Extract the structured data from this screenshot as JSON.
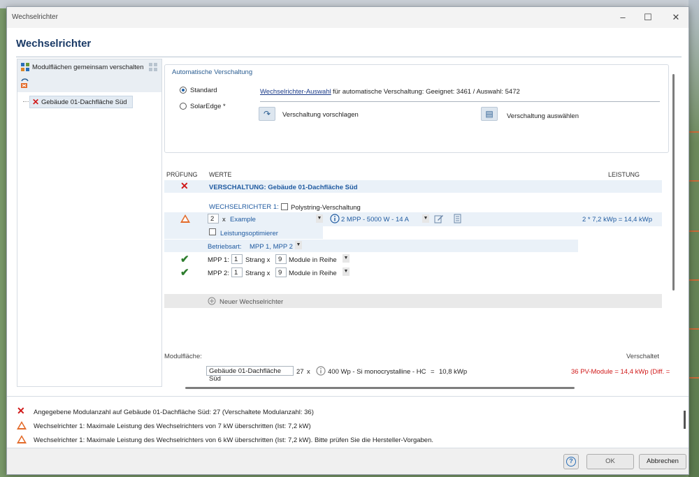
{
  "window": {
    "title": "Wechselrichter",
    "heading": "Wechselrichter"
  },
  "tree": {
    "group_label": "Modulflächen gemeinsam verschalten",
    "item_label": "Gebäude 01-Dachfläche Süd"
  },
  "auto": {
    "title": "Automatische Verschaltung",
    "option_standard": "Standard",
    "option_solaredge": "SolarEdge *",
    "selection_link": "Wechselrichter-Auswahl",
    "selection_text": "für automatische Verschaltung: Geeignet: 3461 / Auswahl: 5472",
    "suggest_label": "Verschaltung vorschlagen",
    "choose_label": "Verschaltung auswählen"
  },
  "columns": {
    "check": "PRÜFUNG",
    "values": "WERTE",
    "power": "LEISTUNG"
  },
  "wiring": {
    "title": "VERSCHALTUNG: Gebäude 01-Dachfläche Süd",
    "inverter_label": "WECHSELRICHTER 1:",
    "polystring_label": "Polystring-Verschaltung",
    "count": "2",
    "x_sep": "x",
    "model": "Example",
    "mpp_info": "2 MPP - 5000 W - 14 A",
    "power_result": "2 * 7,2 kWp = 14,4 kWp",
    "optimizer_label": "Leistungsoptimierer",
    "mode_label": "Betriebsart:",
    "mode_value": "MPP 1, MPP 2",
    "mpps": [
      {
        "label": "MPP 1:",
        "strings": "1",
        "strang": "Strang x",
        "modules": "9",
        "suffix": "Module in Reihe"
      },
      {
        "label": "MPP 2:",
        "strings": "1",
        "strang": "Strang x",
        "modules": "9",
        "suffix": "Module in Reihe"
      }
    ],
    "new_inverter": "Neuer Wechselrichter"
  },
  "module_area": {
    "label": "Modulfläche:",
    "wired_label": "Verschaltet",
    "name": "Gebäude 01-Dachfläche Süd",
    "count": "27",
    "x_sep": "x",
    "module_info": "400 Wp - Si monocrystalline - HC",
    "equals": "=",
    "total": "10,8 kWp",
    "wired_result": "36 PV-Module = 14,4 kWp (Diff. ="
  },
  "messages": [
    {
      "type": "error",
      "text": "Angegebene Modulanzahl auf Gebäude 01-Dachfläche Süd: 27 (Verschaltete Modulanzahl: 36)"
    },
    {
      "type": "warning",
      "text": "Wechselrichter 1:   Maximale Leistung des Wechselrichters von 7 kW überschritten (Ist: 7,2 kW)"
    },
    {
      "type": "warning",
      "text": "Wechselrichter 1:   Maximale Leistung des Wechselrichters von 6 kW überschritten (Ist: 7,2 kW). Bitte prüfen Sie die Hersteller-Vorgaben."
    }
  ],
  "footer": {
    "ok": "OK",
    "cancel": "Abbrechen"
  },
  "colors": {
    "accent": "#1f5aa0",
    "error": "#d01818",
    "warning": "#e36b2a",
    "ok": "#2e7d2e"
  }
}
